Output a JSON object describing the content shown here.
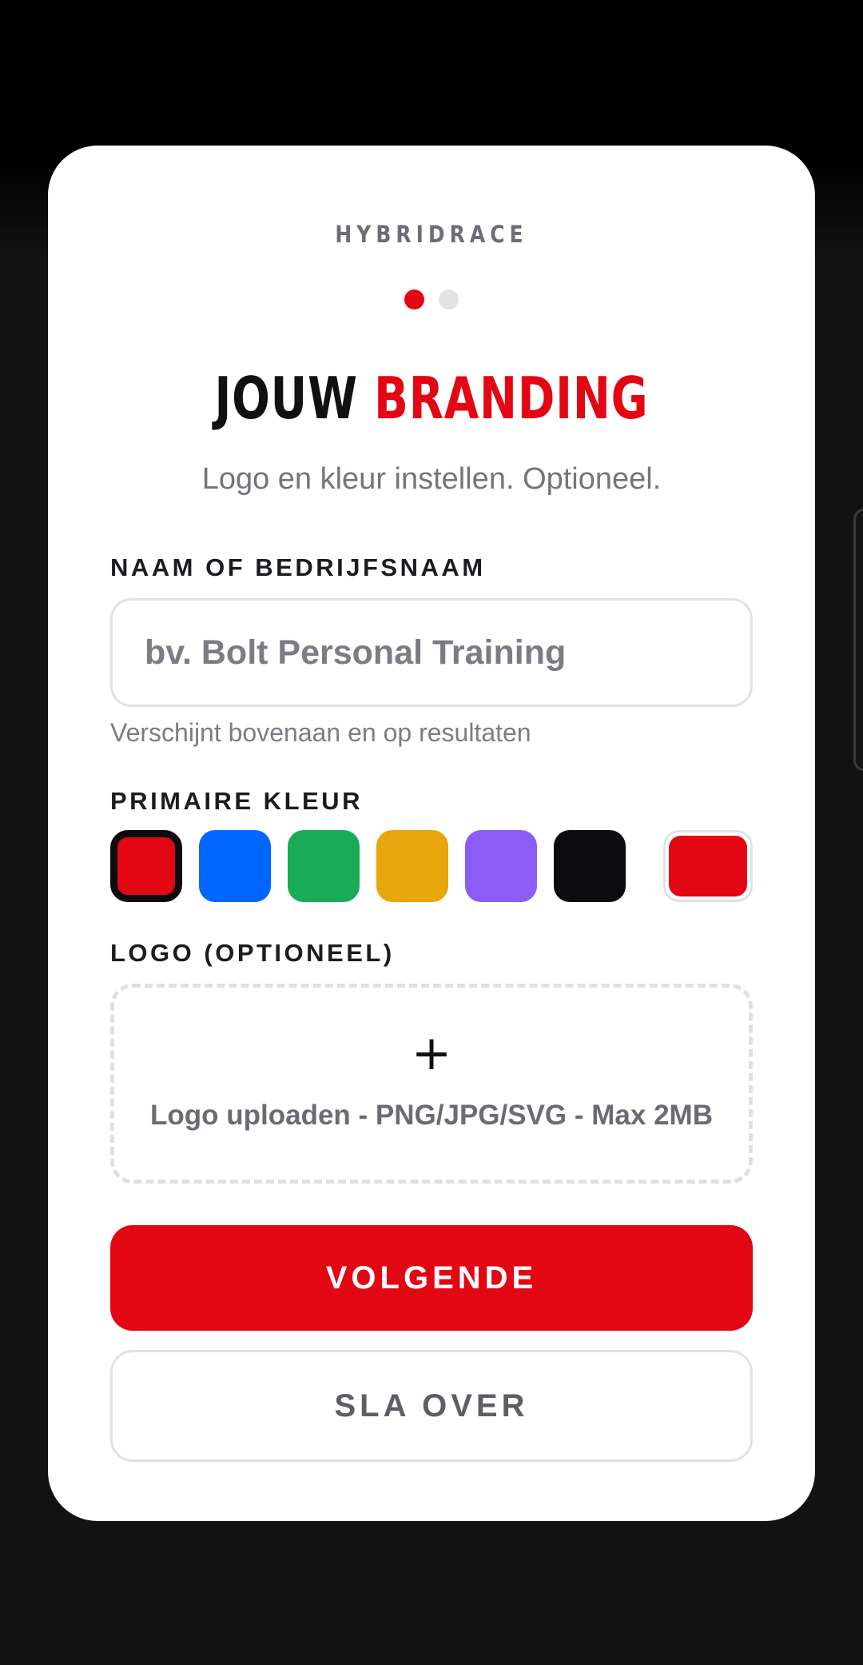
{
  "brand": "HYBRIDRACE",
  "steps": {
    "current": 1,
    "total": 2
  },
  "title": {
    "part1": "JOUW",
    "part2": "BRANDING"
  },
  "subtitle": "Logo en kleur instellen. Optioneel.",
  "name_field": {
    "label": "NAAM OF BEDRIJFSNAAM",
    "value": "",
    "placeholder": "bv. Bolt Personal Training",
    "helper": "Verschijnt bovenaan en op resultaten"
  },
  "primary_color": {
    "label": "PRIMAIRE KLEUR",
    "selected": "#e30613",
    "swatches": [
      {
        "name": "red",
        "color": "#e30613"
      },
      {
        "name": "blue",
        "color": "#0066ff"
      },
      {
        "name": "green",
        "color": "#1aab58"
      },
      {
        "name": "amber",
        "color": "#e8a50c"
      },
      {
        "name": "purple",
        "color": "#8b5cf6"
      },
      {
        "name": "black",
        "color": "#0c0c0e"
      }
    ],
    "custom_color": "#e30613"
  },
  "logo": {
    "label": "LOGO (OPTIONEEL)",
    "icon": "plus-icon",
    "upload_text": "Logo uploaden - PNG/JPG/SVG - Max 2MB"
  },
  "buttons": {
    "next": "VOLGENDE",
    "skip": "SLA OVER"
  },
  "colors": {
    "accent": "#e30613",
    "muted": "#74747c",
    "border": "#e2e2e5"
  }
}
